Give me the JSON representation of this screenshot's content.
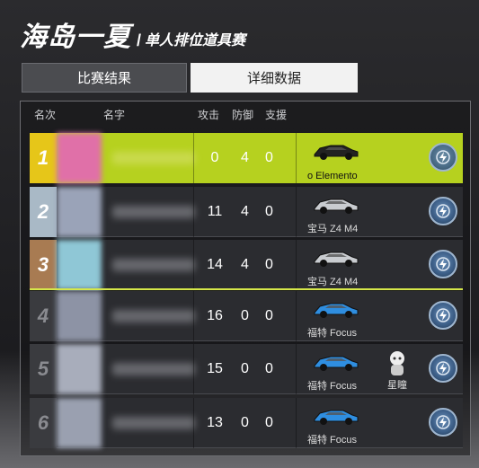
{
  "title": {
    "main": "海岛一夏",
    "separator": "/",
    "sub": "单人排位道具赛"
  },
  "tabs": [
    {
      "label": "比赛结果",
      "active": false
    },
    {
      "label": "详细数据",
      "active": true
    }
  ],
  "table_header": {
    "rank": "名次",
    "name": "名字",
    "attack": "攻击",
    "defense": "防御",
    "support": "支援"
  },
  "rows": [
    {
      "rank": "1",
      "attack": "0",
      "defense": "4",
      "support": "0",
      "car": "o Elemento",
      "pet": "",
      "rank_color": "#e6c619",
      "avatar_color": "#e070a8",
      "car_color": "#222222"
    },
    {
      "rank": "2",
      "attack": "11",
      "defense": "4",
      "support": "0",
      "car": "宝马 Z4 M4",
      "pet": "",
      "rank_color": "#a9b9c6",
      "avatar_color": "#9aa3b8",
      "car_color": "#c9ccd0"
    },
    {
      "rank": "3",
      "attack": "14",
      "defense": "4",
      "support": "0",
      "car": "宝马 Z4 M4",
      "pet": "",
      "rank_color": "#a87b52",
      "avatar_color": "#8fc7d6",
      "car_color": "#c9ccd0"
    },
    {
      "rank": "4",
      "attack": "16",
      "defense": "0",
      "support": "0",
      "car": "福特 Focus",
      "pet": "",
      "rank_color": "#3a3b3f",
      "avatar_color": "#8d93a5",
      "car_color": "#2f8ee0"
    },
    {
      "rank": "5",
      "attack": "15",
      "defense": "0",
      "support": "0",
      "car": "福特 Focus",
      "pet": "星瞳",
      "rank_color": "#3a3b3f",
      "avatar_color": "#a8adbb",
      "car_color": "#2f8ee0"
    },
    {
      "rank": "6",
      "attack": "13",
      "defense": "0",
      "support": "0",
      "car": "福特 Focus",
      "pet": "",
      "rank_color": "#3a3b3f",
      "avatar_color": "#9aa0b0",
      "car_color": "#2f8ee0"
    }
  ],
  "colors": {
    "first_row": "#b6d11f",
    "accent_line": "#d6e84a"
  },
  "icons": {
    "boost": "lightning-boost-icon"
  }
}
